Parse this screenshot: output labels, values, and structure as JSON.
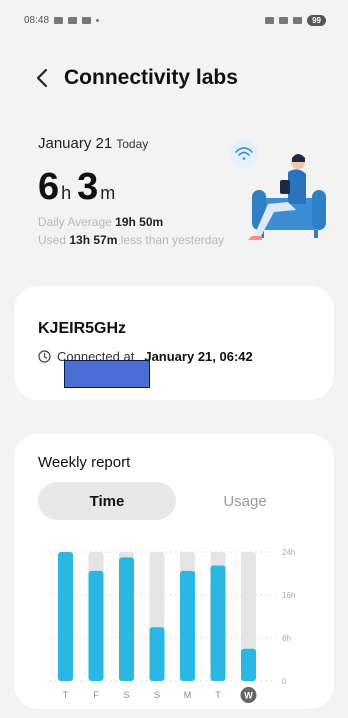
{
  "status_bar": {
    "time": "08:48",
    "battery": "99"
  },
  "header": {
    "title": "Connectivity labs"
  },
  "summary": {
    "date": "January 21",
    "today_label": "Today",
    "hours": "6",
    "hours_unit": "h",
    "minutes": "3",
    "minutes_unit": "m",
    "daily_average_label": "Daily Average",
    "daily_average_value": "19h 50m",
    "used_label": "Used",
    "used_value": "13h 57m",
    "used_suffix": "less than yesterday"
  },
  "wifi": {
    "network_name": "KJEIR5GHz",
    "connected_label": "Connected at",
    "connected_time": "January 21, 06:42"
  },
  "weekly": {
    "title": "Weekly report",
    "tabs": [
      {
        "label": "Time",
        "active": true
      },
      {
        "label": "Usage",
        "active": false
      }
    ]
  },
  "colors": {
    "bar": "#2ab7e3",
    "bar_bg": "#e4e4e4",
    "selected_day": "#666666",
    "redaction": "#4a6ed4",
    "illustration_blue": "#3b8ed6"
  },
  "chart_data": {
    "type": "bar",
    "categories": [
      "T",
      "F",
      "S",
      "S",
      "M",
      "T",
      "W"
    ],
    "values": [
      24,
      20.5,
      23,
      10,
      20.5,
      21.5,
      6
    ],
    "ylim": [
      0,
      24
    ],
    "y_ticks": [
      {
        "value": 24,
        "label": "24h"
      },
      {
        "value": 16,
        "label": "16h"
      },
      {
        "value": 8,
        "label": "8h"
      },
      {
        "value": 0,
        "label": "0"
      }
    ],
    "selected_index": 6,
    "grid": true
  }
}
